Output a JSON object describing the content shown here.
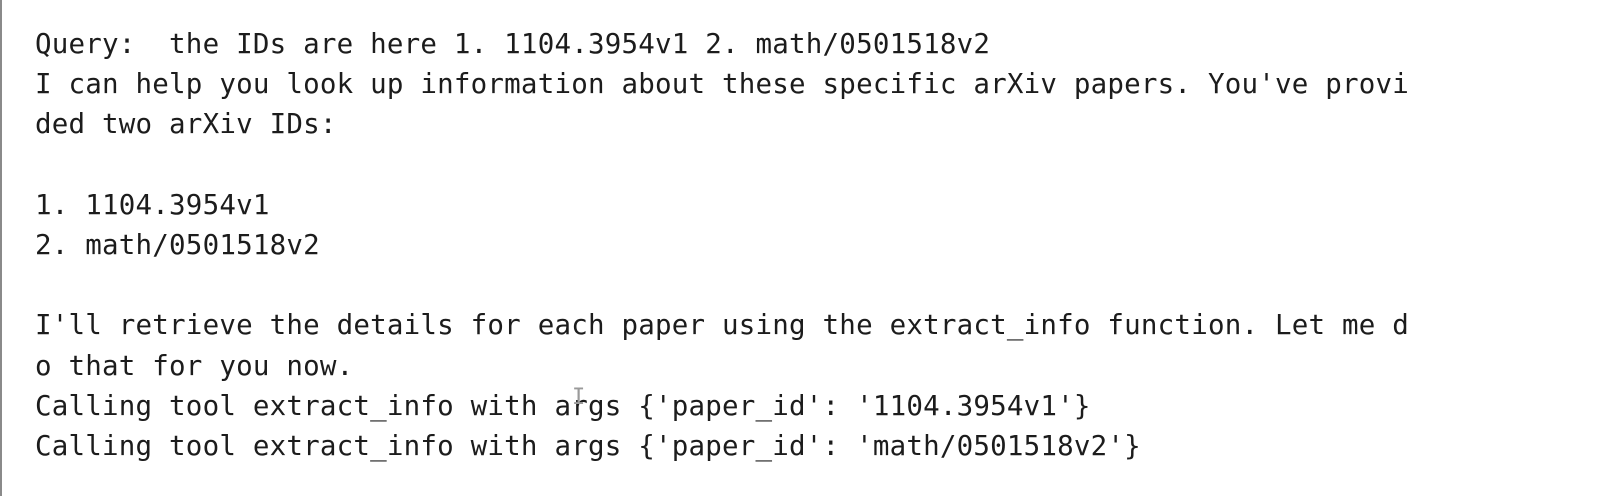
{
  "terminal": {
    "lines": [
      "Query:  the IDs are here 1. 1104.3954v1 2. math/0501518v2",
      "I can help you look up information about these specific arXiv papers. You've provi",
      "ded two arXiv IDs:",
      "",
      "1. 1104.3954v1",
      "2. math/0501518v2",
      "",
      "I'll retrieve the details for each paper using the extract_info function. Let me d",
      "o that for you now.",
      "Calling tool extract_info with args {'paper_id': '1104.3954v1'}",
      "Calling tool extract_info with args {'paper_id': 'math/0501518v2'}"
    ]
  }
}
